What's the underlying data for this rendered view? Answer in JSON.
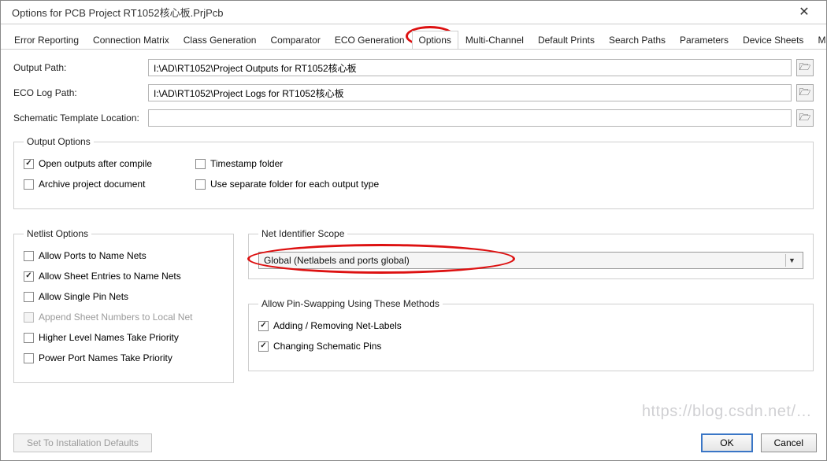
{
  "window": {
    "title": "Options for PCB Project RT1052核心板.PrjPcb",
    "close_glyph": "✕"
  },
  "tabs": {
    "items": [
      "Error Reporting",
      "Connection Matrix",
      "Class Generation",
      "Comparator",
      "ECO Generation",
      "Options",
      "Multi-Channel",
      "Default Prints",
      "Search Paths",
      "Parameters",
      "Device Sheets",
      "Managed O"
    ],
    "active_index": 5,
    "arrow_left": "◀",
    "arrow_right": "▶"
  },
  "paths": {
    "output_label": "Output Path:",
    "output_value": "I:\\AD\\RT1052\\Project Outputs for RT1052核心板",
    "eco_label": "ECO Log Path:",
    "eco_value": "I:\\AD\\RT1052\\Project Logs for RT1052核心板",
    "schematic_label": "Schematic Template Location:",
    "schematic_value": "",
    "browse_glyph": "🗁"
  },
  "output_options": {
    "legend": "Output Options",
    "open_after_compile": "Open outputs after compile",
    "timestamp_folder": "Timestamp folder",
    "archive_project": "Archive project document",
    "separate_folder": "Use separate folder for each output type"
  },
  "netlist_options": {
    "legend": "Netlist Options",
    "allow_ports": "Allow Ports to Name Nets",
    "allow_sheet_entries": "Allow Sheet Entries to Name Nets",
    "allow_single_pin": "Allow Single Pin Nets",
    "append_sheet_numbers": "Append Sheet Numbers to Local Net",
    "higher_level_priority": "Higher Level Names Take Priority",
    "power_port_priority": "Power Port Names Take Priority"
  },
  "net_id_scope": {
    "legend": "Net Identifier Scope",
    "selected": "Global (Netlabels and ports global)"
  },
  "pin_swap": {
    "legend": "Allow Pin-Swapping Using These Methods",
    "adding_removing": "Adding / Removing Net-Labels",
    "changing_pins": "Changing Schematic Pins"
  },
  "buttons": {
    "defaults": "Set To Installation Defaults",
    "ok": "OK",
    "cancel": "Cancel"
  },
  "watermark": "https://blog.csdn.net/…"
}
